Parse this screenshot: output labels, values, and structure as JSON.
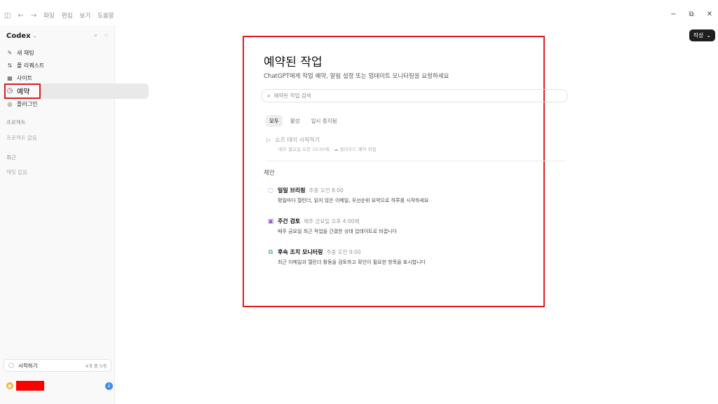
{
  "titlebar": {
    "menu": [
      "파일",
      "편집",
      "보기",
      "도움말"
    ],
    "window_controls": [
      "−",
      "⧉",
      "✕"
    ]
  },
  "compose_button": {
    "label": "작성"
  },
  "sidebar": {
    "app_name": "Codex",
    "nav": [
      {
        "label": "새 채팅",
        "icon": "edit-icon"
      },
      {
        "label": "풀 리퀘스트",
        "icon": "pull-request-icon"
      },
      {
        "label": "사이트",
        "icon": "sites-icon"
      },
      {
        "label": "예약",
        "icon": "clock-icon"
      },
      {
        "label": "플러그인",
        "icon": "plugin-icon"
      }
    ],
    "projects_header": "프로젝트",
    "projects_empty": "프로젝트 없음",
    "recent_header": "최근",
    "recent_empty": "채팅 없음",
    "getting_started": {
      "label": "시작하기",
      "count": "4개 중 0개"
    }
  },
  "main": {
    "title": "예약된 작업",
    "subtitle": "ChatGPT에게 작업 예약, 알림 설정 또는 업데이트 모니터링을 요청하세요",
    "search_placeholder": "예약된 작업 검색",
    "filters": [
      "모두",
      "활성",
      "일시 중지됨"
    ],
    "selected_filter": "모두",
    "tasks": [
      {
        "name": "쇼츠 데이 시작하기",
        "schedule": "매주 월요일 오전 10:00에",
        "separator": "·",
        "type": "클라우드 예약 작업"
      }
    ],
    "suggestions_header": "제안",
    "suggestions": [
      {
        "name": "일일 브리핑",
        "when": "주중 오전 8:00",
        "desc": "평일마다 캘린더, 읽지 않은 이메일, 우선순위 요약으로 하루를 시작하세요",
        "color": "#2f8ff0",
        "icon": "bell-icon"
      },
      {
        "name": "주간 검토",
        "when": "매주 금요일 오후 4:00에",
        "desc": "매주 금요일 최근 작업을 간결한 상태 업데이트로 바꿉니다",
        "color": "#9b59d0",
        "icon": "calendar-icon"
      },
      {
        "name": "후속 조치 모니터링",
        "when": "주중 오전 9:00",
        "desc": "최근 이메일과 캘린더 활동을 검토하고 확인이 필요한 항목을 표시합니다",
        "color": "#22a052",
        "icon": "followup-icon"
      }
    ]
  }
}
